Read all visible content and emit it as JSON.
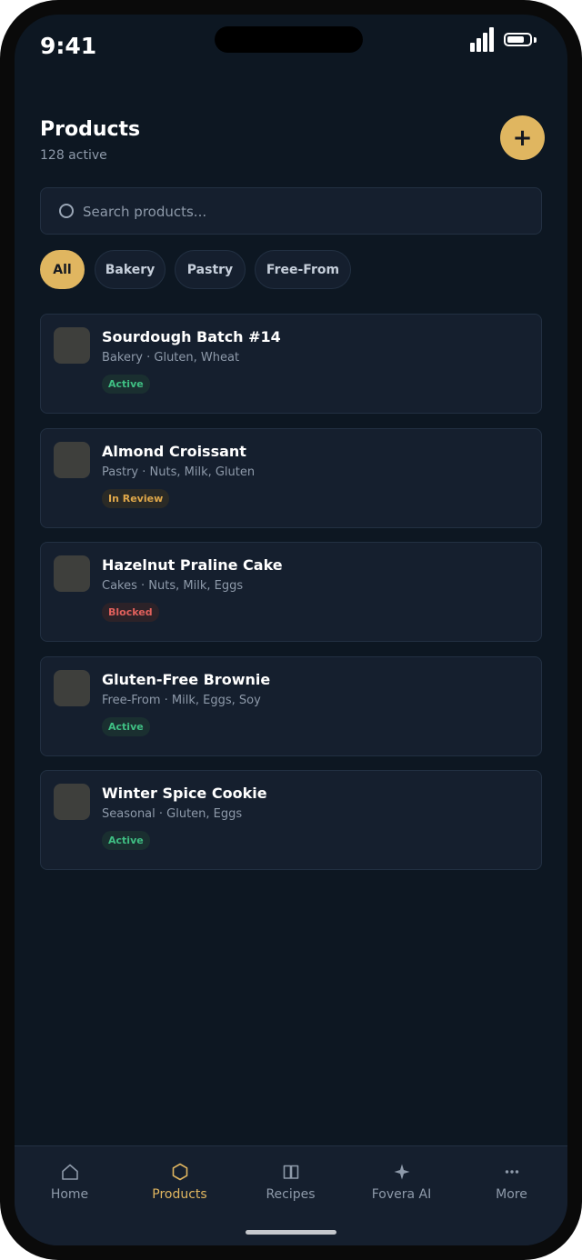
{
  "status_bar": {
    "time": "9:41",
    "battery_level": 0.8,
    "signal_bars": 4
  },
  "header": {
    "title": "Products",
    "subtitle": "128 active",
    "add_icon": "plus-icon"
  },
  "search": {
    "placeholder": "Search products...",
    "value": ""
  },
  "filters": [
    {
      "label": "All",
      "selected": true
    },
    {
      "label": "Bakery",
      "selected": false
    },
    {
      "label": "Pastry",
      "selected": false
    },
    {
      "label": "Free-From",
      "selected": false
    }
  ],
  "products": [
    {
      "name": "Sourdough Batch #14",
      "meta": "Bakery · Gluten, Wheat",
      "status": "Active"
    },
    {
      "name": "Almond Croissant",
      "meta": "Pastry · Nuts, Milk, Gluten",
      "status": "In Review"
    },
    {
      "name": "Hazelnut Praline Cake",
      "meta": "Cakes · Nuts, Milk, Eggs",
      "status": "Blocked"
    },
    {
      "name": "Gluten-Free Brownie",
      "meta": "Free-From · Milk, Eggs, Soy",
      "status": "Active"
    },
    {
      "name": "Winter Spice Cookie",
      "meta": "Seasonal · Gluten, Eggs",
      "status": "Active"
    }
  ],
  "status_colors": {
    "Active": {
      "text": "#3fbf83",
      "bg": "#1a2f30"
    },
    "In Review": {
      "text": "#e0a84a",
      "bg": "#2a2a26"
    },
    "Blocked": {
      "text": "#e0605c",
      "bg": "#2c2228"
    }
  },
  "tabbar": [
    {
      "label": "Home",
      "icon": "home-icon",
      "active": false
    },
    {
      "label": "Products",
      "icon": "box-icon",
      "active": true
    },
    {
      "label": "Recipes",
      "icon": "book-icon",
      "active": false
    },
    {
      "label": "Fovera AI",
      "icon": "sparkle-icon",
      "active": false
    },
    {
      "label": "More",
      "icon": "more-icon",
      "active": false
    }
  ],
  "colors": {
    "accent": "#e0b660",
    "background": "#0d1722",
    "card": "#151f2e"
  }
}
